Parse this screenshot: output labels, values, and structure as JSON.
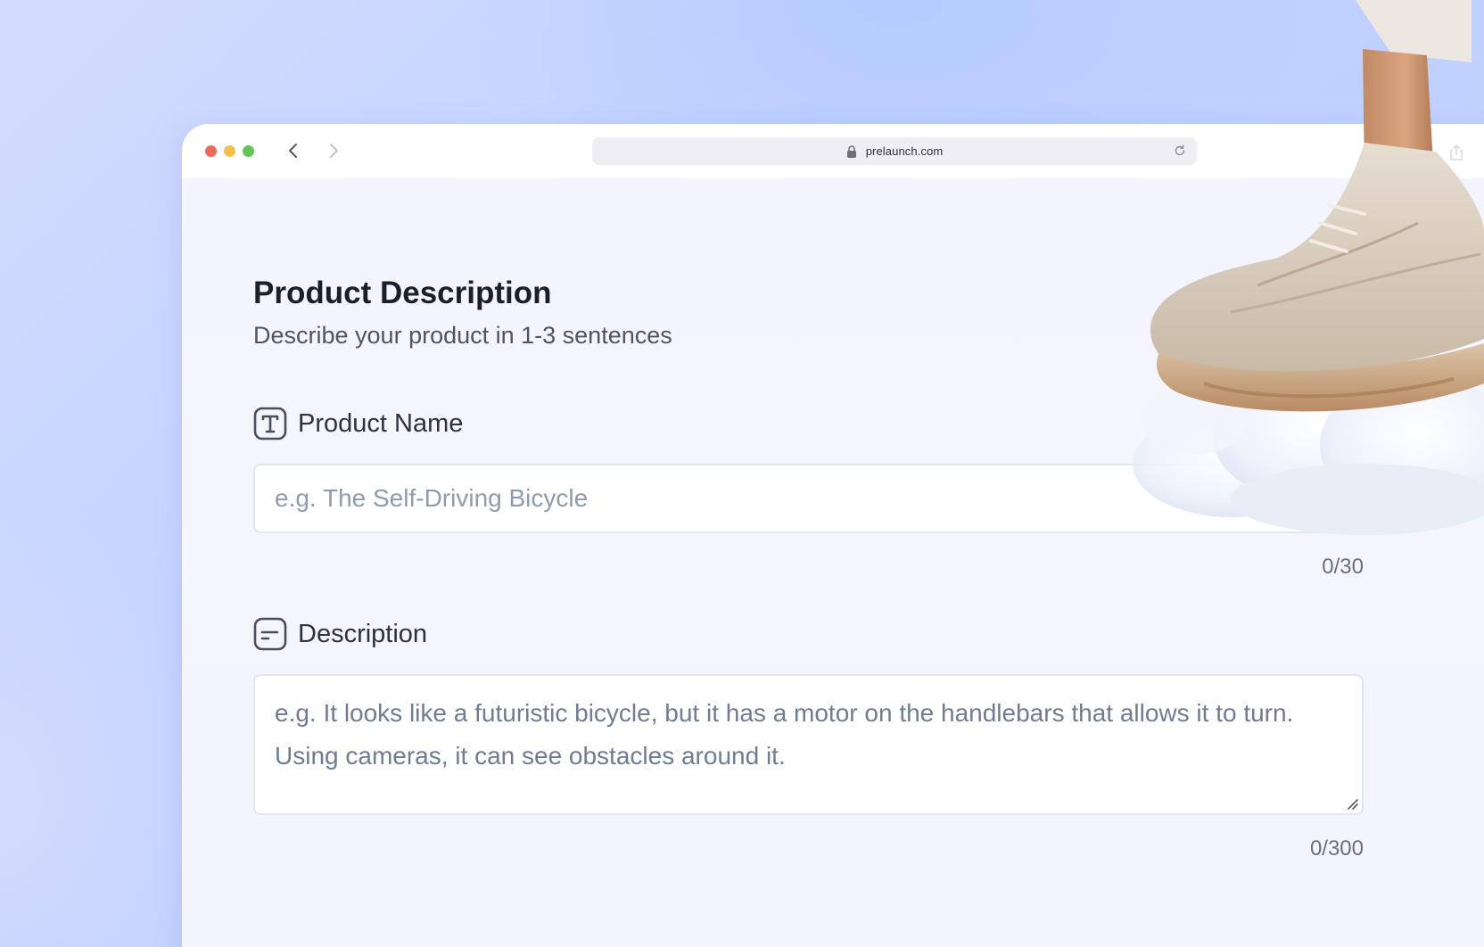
{
  "browser": {
    "url": "prelaunch.com",
    "icons": {
      "back": "chevron-left-icon",
      "forward": "chevron-right-icon",
      "lock": "lock-icon",
      "reload": "reload-icon",
      "share": "share-icon"
    }
  },
  "form": {
    "title": "Product Description",
    "subtitle": "Describe your product in 1-3 sentences",
    "product_name": {
      "label": "Product Name",
      "icon": "text-type-icon",
      "placeholder": "e.g. The Self-Driving Bicycle",
      "value": "",
      "counter": "0/30"
    },
    "description": {
      "label": "Description",
      "icon": "document-text-icon",
      "placeholder": "e.g. It looks like a futuristic bicycle, but it has a motor on the handlebars that allows it to turn. Using cameras, it can see obstacles around it.",
      "value": "",
      "counter": "0/300"
    }
  },
  "colors": {
    "background": "#c8d6ff",
    "title": "#1d1d2b",
    "placeholder": "#8f9bb0",
    "traffic_red": "#ec6a5e",
    "traffic_yellow": "#f4bf4f",
    "traffic_green": "#61c554"
  }
}
